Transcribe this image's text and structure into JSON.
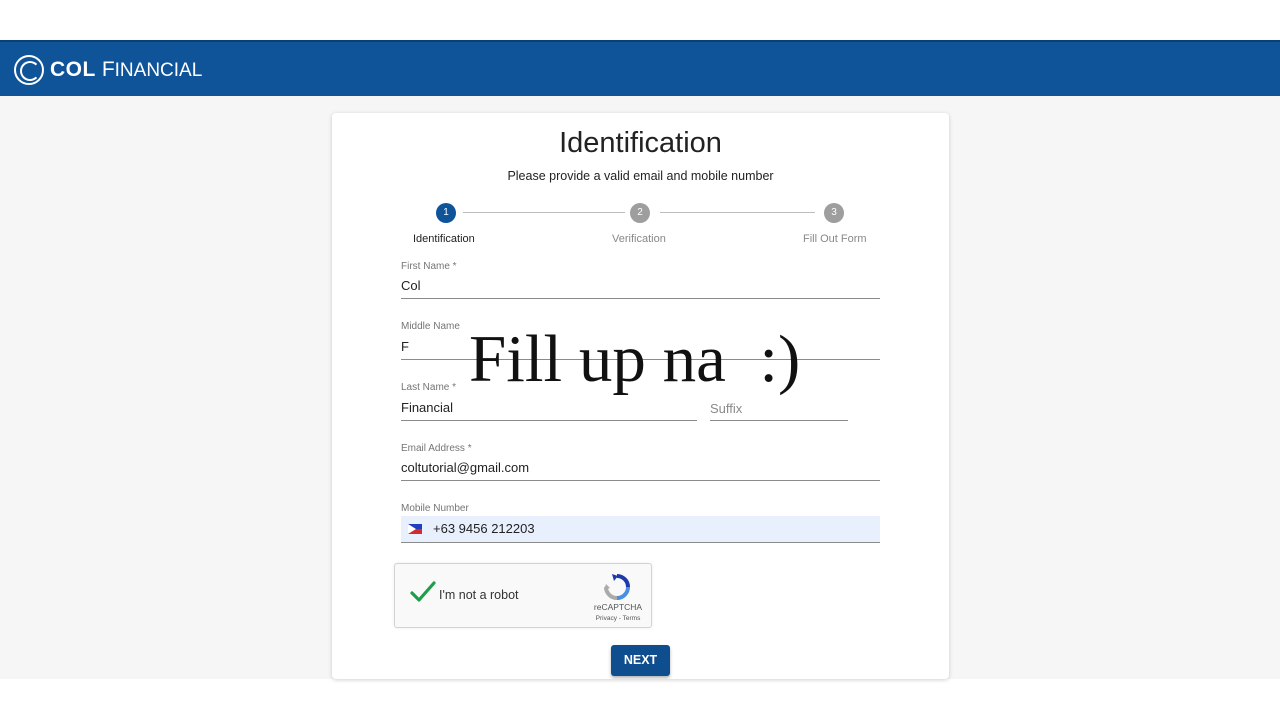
{
  "brand": {
    "name_bold": "COL",
    "name_rest_initial": "F",
    "name_rest": "INANCIAL",
    "header_color": "#0f5499"
  },
  "form": {
    "title": "Identification",
    "subtitle": "Please provide a valid email and mobile number"
  },
  "stepper": {
    "steps": [
      {
        "number": "1",
        "label": "Identification",
        "state": "active"
      },
      {
        "number": "2",
        "label": "Verification",
        "state": "inactive"
      },
      {
        "number": "3",
        "label": "Fill Out Form",
        "state": "inactive"
      }
    ]
  },
  "fields": {
    "first_name": {
      "label": "First Name *",
      "value": "Col"
    },
    "middle_name": {
      "label": "Middle Name",
      "value": "F"
    },
    "last_name": {
      "label": "Last Name *",
      "value": "Financial"
    },
    "suffix": {
      "placeholder": "Suffix"
    },
    "email": {
      "label": "Email Address *",
      "value": "coltutorial@gmail.com"
    },
    "mobile": {
      "label": "Mobile Number",
      "value": "+63 9456 212203",
      "country_icon": "philippines-flag-icon"
    }
  },
  "captcha": {
    "label": "I'm not a robot",
    "brand": "reCAPTCHA",
    "terms": "Privacy - Terms",
    "checked": true
  },
  "actions": {
    "next_label": "NEXT"
  },
  "overlay": {
    "text": "Fill up na  :)"
  }
}
